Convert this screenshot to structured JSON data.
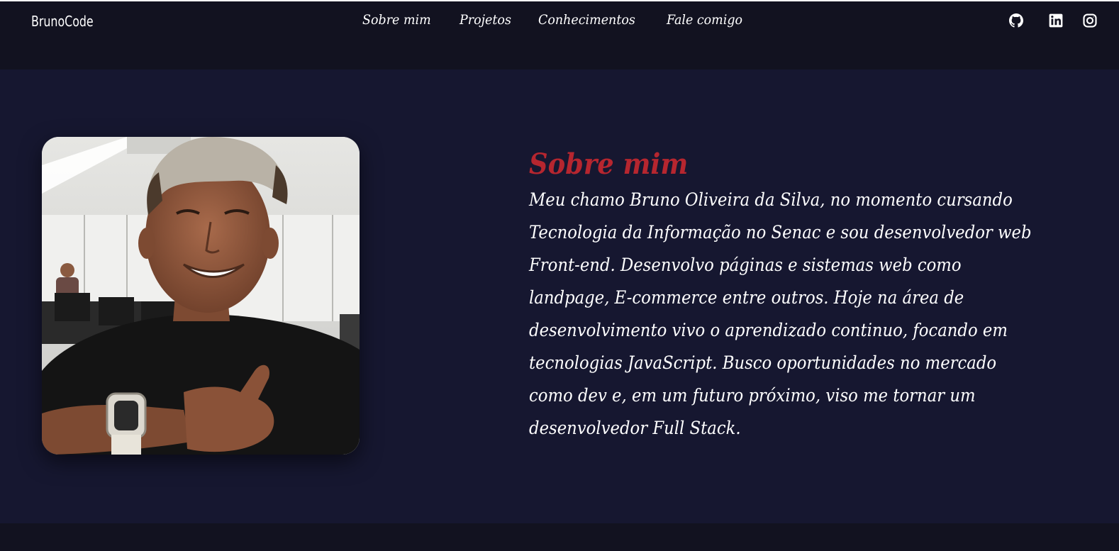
{
  "header": {
    "logo": "BrunoCode",
    "nav": [
      {
        "label": "Sobre mim"
      },
      {
        "label": "Projetos"
      },
      {
        "label": "Conhecimentos"
      },
      {
        "label": "Fale comigo"
      }
    ],
    "social": [
      {
        "icon": "github-icon"
      },
      {
        "icon": "linkedin-icon"
      },
      {
        "icon": "instagram-icon"
      }
    ]
  },
  "about": {
    "title": "Sobre mim",
    "paragraph_lines": [
      "Meu chamo Bruno Oliveira da Silva, no momento cursando",
      "Tecnologia da Informação no Senac e sou desenvolvedor web",
      "Front-end. Desenvolvo páginas e sistemas web como",
      "landpage, E-commerce entre outros. Hoje na área de",
      "desenvolvimento vivo o aprendizado continuo, focando em",
      "tecnologias JavaScript. Busco oportunidades no mercado",
      "como dev e, em um futuro próximo, viso me tornar um",
      "desenvolvedor Full Stack."
    ]
  },
  "colors": {
    "header_bg": "#121220",
    "section_bg": "#161730",
    "accent_title": "#b6262f",
    "text": "#ffffff"
  }
}
